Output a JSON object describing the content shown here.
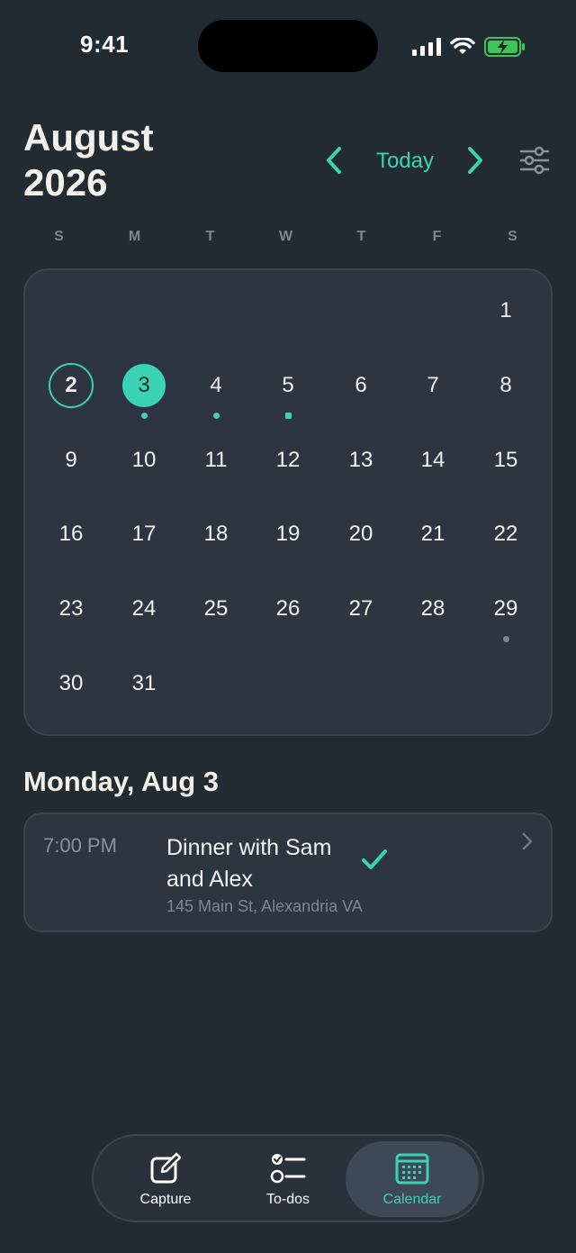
{
  "status_bar": {
    "time": "9:41"
  },
  "header": {
    "month": "August",
    "year": "2026",
    "today_label": "Today"
  },
  "weekdays": [
    "S",
    "M",
    "T",
    "W",
    "T",
    "F",
    "S"
  ],
  "calendar": {
    "days": [
      {
        "n": "1",
        "col": 6,
        "row": 0
      },
      {
        "n": "2",
        "col": 0,
        "row": 1,
        "state": "today"
      },
      {
        "n": "3",
        "col": 1,
        "row": 1,
        "state": "selected",
        "dot": "teal"
      },
      {
        "n": "4",
        "col": 2,
        "row": 1,
        "dot": "teal"
      },
      {
        "n": "5",
        "col": 3,
        "row": 1,
        "dot": "teal-square"
      },
      {
        "n": "6",
        "col": 4,
        "row": 1
      },
      {
        "n": "7",
        "col": 5,
        "row": 1
      },
      {
        "n": "8",
        "col": 6,
        "row": 1
      },
      {
        "n": "9",
        "col": 0,
        "row": 2
      },
      {
        "n": "10",
        "col": 1,
        "row": 2
      },
      {
        "n": "11",
        "col": 2,
        "row": 2
      },
      {
        "n": "12",
        "col": 3,
        "row": 2
      },
      {
        "n": "13",
        "col": 4,
        "row": 2
      },
      {
        "n": "14",
        "col": 5,
        "row": 2
      },
      {
        "n": "15",
        "col": 6,
        "row": 2
      },
      {
        "n": "16",
        "col": 0,
        "row": 3
      },
      {
        "n": "17",
        "col": 1,
        "row": 3
      },
      {
        "n": "18",
        "col": 2,
        "row": 3
      },
      {
        "n": "19",
        "col": 3,
        "row": 3
      },
      {
        "n": "20",
        "col": 4,
        "row": 3
      },
      {
        "n": "21",
        "col": 5,
        "row": 3
      },
      {
        "n": "22",
        "col": 6,
        "row": 3
      },
      {
        "n": "23",
        "col": 0,
        "row": 4
      },
      {
        "n": "24",
        "col": 1,
        "row": 4
      },
      {
        "n": "25",
        "col": 2,
        "row": 4
      },
      {
        "n": "26",
        "col": 3,
        "row": 4
      },
      {
        "n": "27",
        "col": 4,
        "row": 4
      },
      {
        "n": "28",
        "col": 5,
        "row": 4
      },
      {
        "n": "29",
        "col": 6,
        "row": 4,
        "dot": "grey"
      },
      {
        "n": "30",
        "col": 0,
        "row": 5
      },
      {
        "n": "31",
        "col": 1,
        "row": 5
      }
    ]
  },
  "selected_date_heading": "Monday, Aug 3",
  "event": {
    "time": "7:00 PM",
    "title": "Dinner with Sam and Alex",
    "location": "145 Main St, Alexandria VA",
    "status_icon": "checkmark-icon"
  },
  "tabs": [
    {
      "label": "Capture",
      "icon": "edit-icon"
    },
    {
      "label": "To-dos",
      "icon": "checklist-icon"
    },
    {
      "label": "Calendar",
      "icon": "calendar-icon",
      "active": true
    }
  ],
  "colors": {
    "background": "#222a32",
    "card": "#2d3640",
    "accent": "#3bd3b4",
    "muted": "#7d8790",
    "title": "#f4f1ea"
  }
}
